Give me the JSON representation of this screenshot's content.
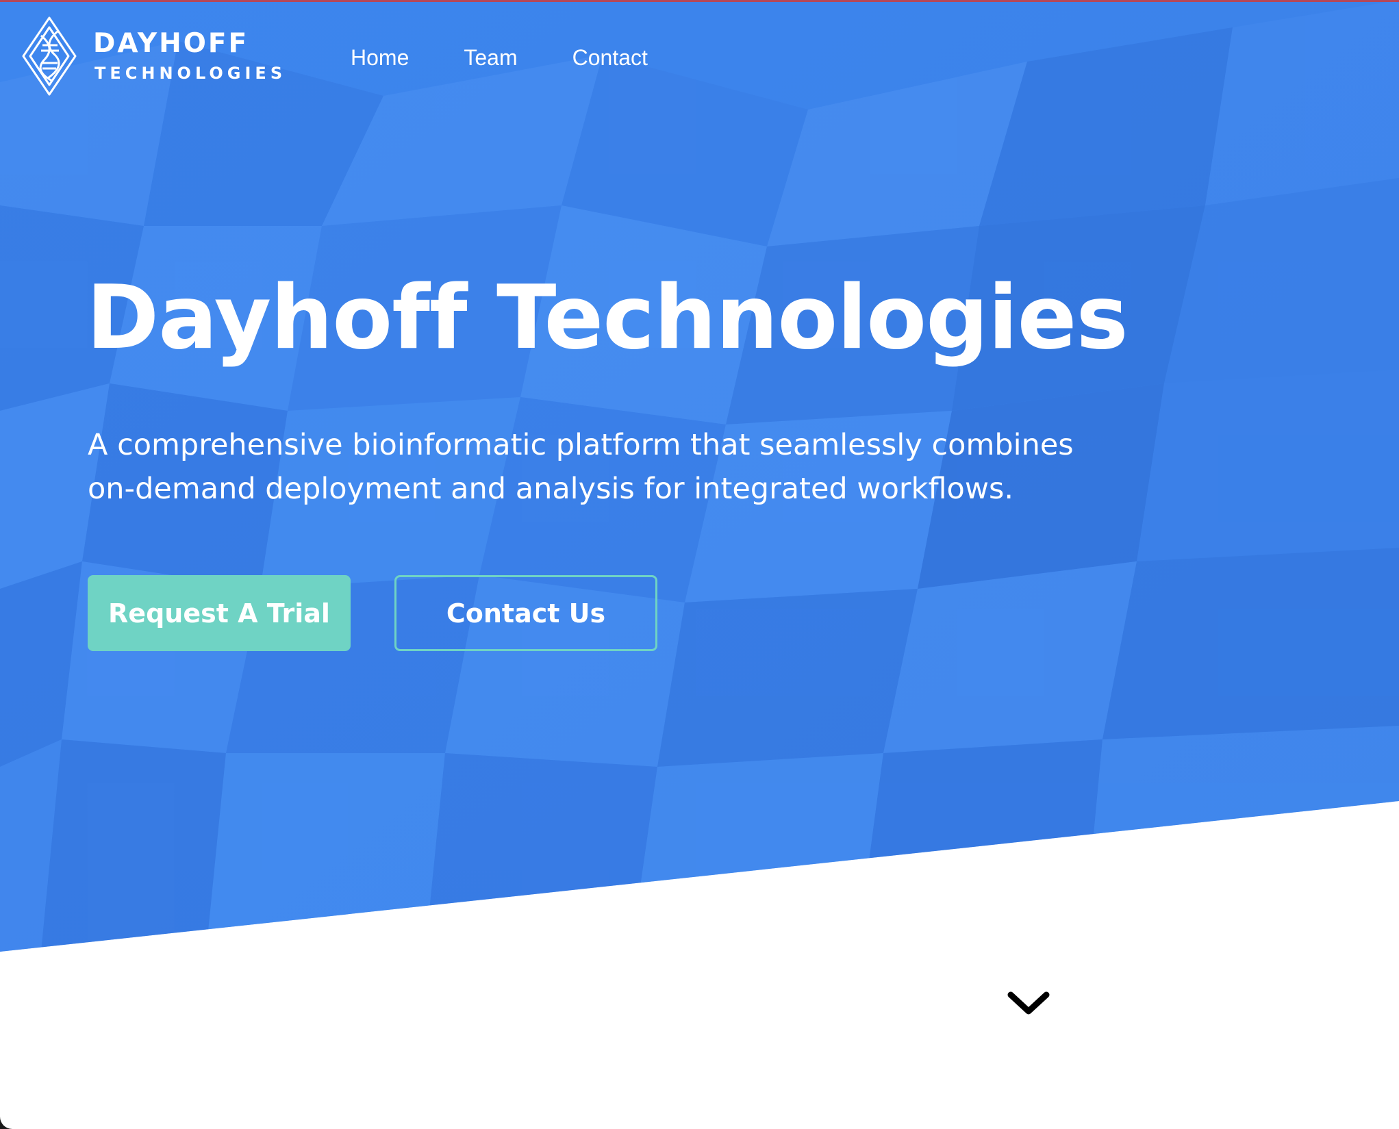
{
  "brand": {
    "name": "DAYHOFF",
    "subname": "TECHNOLOGIES",
    "logo_icon": "helix-diamond-icon"
  },
  "nav": {
    "items": [
      {
        "label": "Home"
      },
      {
        "label": "Team"
      },
      {
        "label": "Contact"
      }
    ]
  },
  "hero": {
    "title": "Dayhoff Technologies",
    "subtitle": "A comprehensive bioinformatic platform that seamlessly combines on-demand deployment and analysis for integrated workflows.",
    "primary_button": "Request A Trial",
    "secondary_button": "Contact Us",
    "scroll_icon": "chevron-down-icon"
  },
  "colors": {
    "hero_blue": "#3f86ec",
    "accent_teal": "#6fd3c4",
    "top_rule": "#b4485a",
    "text": "#ffffff",
    "background": "#ffffff"
  }
}
